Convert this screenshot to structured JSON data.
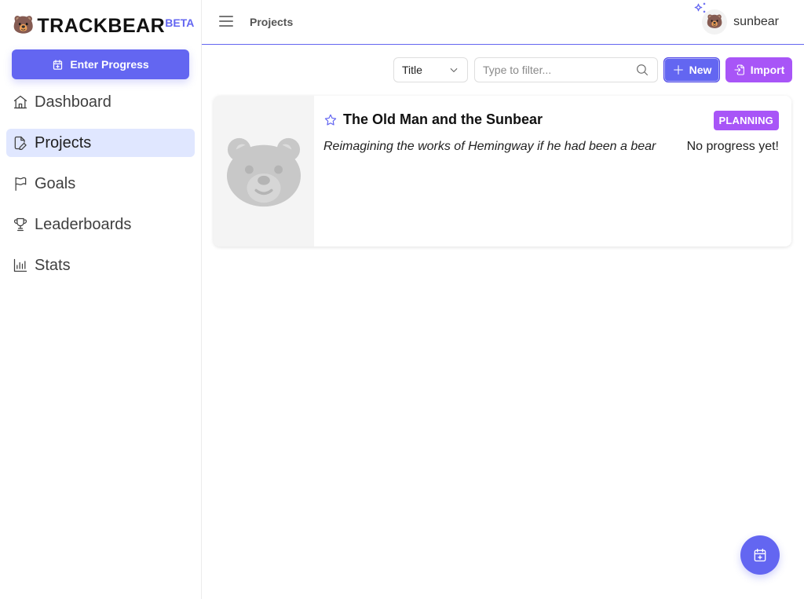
{
  "app": {
    "logo_emoji": "🐻",
    "logo_text": "TRACKBEAR",
    "logo_badge": "BETA"
  },
  "sidebar": {
    "enter_progress_label": "Enter Progress",
    "items": [
      {
        "label": "Dashboard",
        "icon": "home-icon",
        "active": false
      },
      {
        "label": "Projects",
        "icon": "file-pencil-icon",
        "active": true
      },
      {
        "label": "Goals",
        "icon": "flag-icon",
        "active": false
      },
      {
        "label": "Leaderboards",
        "icon": "trophy-icon",
        "active": false
      },
      {
        "label": "Stats",
        "icon": "bar-chart-icon",
        "active": false
      }
    ]
  },
  "header": {
    "breadcrumb": "Projects",
    "user": {
      "avatar_emoji": "🐻",
      "username": "sunbear"
    }
  },
  "toolbar": {
    "sort_value": "Title",
    "filter_placeholder": "Type to filter...",
    "filter_value": "",
    "new_label": "New",
    "import_label": "Import"
  },
  "projects": [
    {
      "title": "The Old Man and the Sunbear",
      "description": "Reimagining the works of Hemingway if he had been a bear",
      "status": "PLANNING",
      "progress_text": "No progress yet!",
      "starred": false
    }
  ],
  "colors": {
    "accent": "#6366f1",
    "secondary": "#a855f7",
    "active_nav_bg": "#e0e7ff"
  }
}
